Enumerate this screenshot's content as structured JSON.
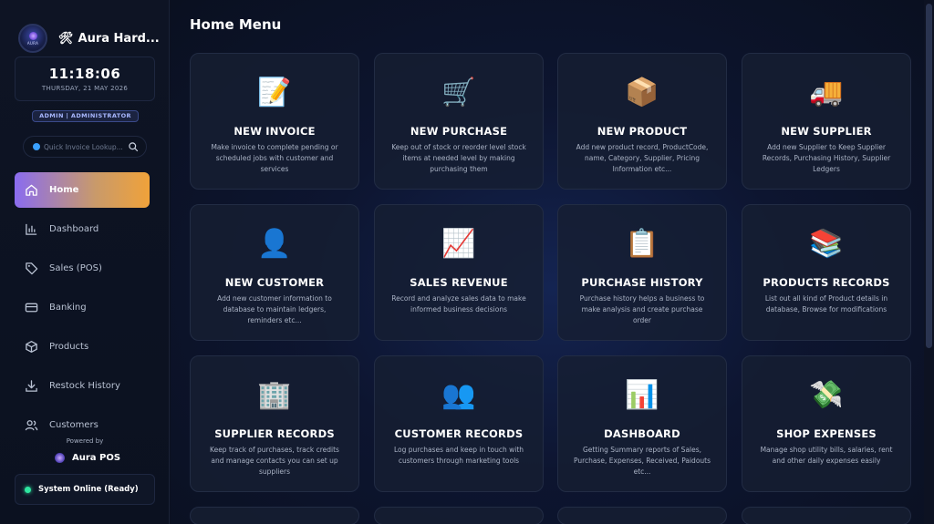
{
  "brand": {
    "title": "Aura Hard...",
    "logo_text": "AURA"
  },
  "clock": {
    "time": "11:18:06",
    "date": "THURSDAY, 21 MAY 2026"
  },
  "role": "ADMIN | ADMINISTRATOR",
  "search": {
    "placeholder": "Quick Invoice Lookup..."
  },
  "nav": [
    {
      "label": "Home",
      "icon": "home-icon",
      "active": true
    },
    {
      "label": "Dashboard",
      "icon": "chart-icon"
    },
    {
      "label": "Sales (POS)",
      "icon": "tag-icon"
    },
    {
      "label": "Banking",
      "icon": "card-icon"
    },
    {
      "label": "Products",
      "icon": "box-icon"
    },
    {
      "label": "Restock History",
      "icon": "download-icon"
    },
    {
      "label": "Customers",
      "icon": "users-icon"
    }
  ],
  "footer": {
    "powered_by": "Powered by",
    "pos_name": "Aura POS",
    "status": "System Online (Ready)"
  },
  "main": {
    "title": "Home Menu",
    "cards": [
      {
        "icon": "📝",
        "title": "NEW INVOICE",
        "desc": "Make invoice to complete pending or scheduled jobs with customer and services"
      },
      {
        "icon": "🛒",
        "title": "NEW PURCHASE",
        "desc": "Keep out of stock or reorder level stock items at needed level by making purchasing them"
      },
      {
        "icon": "📦",
        "title": "NEW PRODUCT",
        "desc": "Add new product record, ProductCode, name, Category, Supplier, Pricing Information etc..."
      },
      {
        "icon": "🚚",
        "title": "NEW SUPPLIER",
        "desc": "Add new Supplier to Keep Supplier Records, Purchasing History, Supplier Ledgers"
      },
      {
        "icon": "👤",
        "title": "NEW CUSTOMER",
        "desc": "Add new customer information to database to maintain ledgers, reminders etc..."
      },
      {
        "icon": "📈",
        "title": "SALES REVENUE",
        "desc": "Record and analyze sales data to make informed business decisions"
      },
      {
        "icon": "📋",
        "title": "PURCHASE HISTORY",
        "desc": "Purchase history helps a business to make analysis and create purchase order"
      },
      {
        "icon": "📚",
        "title": "PRODUCTS RECORDS",
        "desc": "List out all kind of Product details in database, Browse for modifications"
      },
      {
        "icon": "🏢",
        "title": "SUPPLIER RECORDS",
        "desc": "Keep track of purchases, track credits and manage contacts you can set up suppliers"
      },
      {
        "icon": "👥",
        "title": "CUSTOMER RECORDS",
        "desc": "Log purchases and keep in touch with customers through marketing tools"
      },
      {
        "icon": "📊",
        "title": "DASHBOARD",
        "desc": "Getting Summary reports of Sales, Purchase, Expenses, Received, Paidouts etc..."
      },
      {
        "icon": "💸",
        "title": "SHOP EXPENSES",
        "desc": "Manage shop utility bills, salaries, rent and other daily expenses easily"
      }
    ]
  }
}
